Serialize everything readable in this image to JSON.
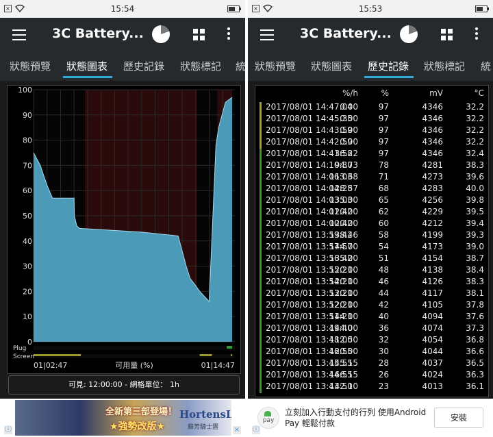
{
  "left": {
    "status": {
      "time": "15:54"
    },
    "app": {
      "title": "3C Battery..."
    },
    "tabs": [
      "狀態預覽",
      "狀態圖表",
      "歷史記錄",
      "狀態標記",
      "統"
    ],
    "active_tab": 1,
    "chart": {
      "x_start": "01|02:47",
      "x_end": "01|14:47",
      "xlabel": "可用量 (%)",
      "plug_label": "Plug",
      "screen_label": "Screen"
    },
    "visible_bar": "可見: 12:00:00 - 網格單位： 1h",
    "ad": {
      "line1": "全新第三部登場！",
      "line2": "★強勢改版★",
      "logo": "HortensIA",
      "logo_sub": "蘇芳騎士團"
    }
  },
  "right": {
    "status": {
      "time": "15:53"
    },
    "app": {
      "title": "3C Battery..."
    },
    "tabs": [
      "狀態預覽",
      "狀態圖表",
      "歷史記錄",
      "狀態標記",
      "統"
    ],
    "active_tab": 2,
    "table": {
      "headers": {
        "rate": "%/h",
        "percent": "%",
        "mv": "mV",
        "temp": "°C"
      },
      "rows": [
        {
          "ts": "2017/08/01  14:47:04",
          "rate": "0.00",
          "pct": "97",
          "mv": "4346",
          "temp": "32.2",
          "mark": "#a8a032"
        },
        {
          "ts": "2017/08/01  14:45:35",
          "rate": "0.00",
          "pct": "97",
          "mv": "4346",
          "temp": "32.2",
          "mark": "#a8a032"
        },
        {
          "ts": "2017/08/01  14:43:59",
          "rate": "0.00",
          "pct": "97",
          "mv": "4346",
          "temp": "32.2",
          "mark": "#a8a032"
        },
        {
          "ts": "2017/08/01  14:42:59",
          "rate": "0.00",
          "pct": "97",
          "mv": "4346",
          "temp": "32.2",
          "mark": "#a8a032"
        },
        {
          "ts": "2017/08/01  14:41:58",
          "rate": "36.22",
          "pct": "97",
          "mv": "4346",
          "temp": "32.4",
          "mark": "#3a9a2a"
        },
        {
          "ts": "2017/08/01  14:10:30",
          "rate": "94.73",
          "pct": "78",
          "mv": "4281",
          "temp": "38.3",
          "mark": "#3a9a2a"
        },
        {
          "ts": "2017/08/01  14:06:03",
          "rate": "113.68",
          "pct": "71",
          "mv": "4273",
          "temp": "39.6",
          "mark": "#3a9a2a"
        },
        {
          "ts": "2017/08/01  14:04:28",
          "rate": "128.57",
          "pct": "68",
          "mv": "4283",
          "temp": "40.0",
          "mark": "#3a9a2a"
        },
        {
          "ts": "2017/08/01  14:03:03",
          "rate": "135.00",
          "pct": "65",
          "mv": "4256",
          "temp": "39.8",
          "mark": "#3a9a2a"
        },
        {
          "ts": "2017/08/01  14:01:42",
          "rate": "120.00",
          "pct": "62",
          "mv": "4229",
          "temp": "39.5",
          "mark": "#3a9a2a"
        },
        {
          "ts": "2017/08/01  14:00:42",
          "rate": "120.00",
          "pct": "60",
          "mv": "4212",
          "temp": "39.4",
          "mark": "#3a9a2a"
        },
        {
          "ts": "2017/08/01  13:59:42",
          "rate": "138.46",
          "pct": "58",
          "mv": "4199",
          "temp": "39.3",
          "mark": "#3a9a2a"
        },
        {
          "ts": "2017/08/01  13:57:57",
          "rate": "144.00",
          "pct": "54",
          "mv": "4173",
          "temp": "39.0",
          "mark": "#3a9a2a"
        },
        {
          "ts": "2017/08/01  13:56:42",
          "rate": "135.00",
          "pct": "51",
          "mv": "4154",
          "temp": "38.7",
          "mark": "#3a9a2a"
        },
        {
          "ts": "2017/08/01  13:55:21",
          "rate": "120.00",
          "pct": "48",
          "mv": "4138",
          "temp": "38.4",
          "mark": "#3a9a2a"
        },
        {
          "ts": "2017/08/01  13:54:21",
          "rate": "120.00",
          "pct": "46",
          "mv": "4126",
          "temp": "38.3",
          "mark": "#3a9a2a"
        },
        {
          "ts": "2017/08/01  13:53:21",
          "rate": "120.00",
          "pct": "44",
          "mv": "4117",
          "temp": "38.1",
          "mark": "#3a9a2a"
        },
        {
          "ts": "2017/08/01  13:52:21",
          "rate": "120.00",
          "pct": "42",
          "mv": "4105",
          "temp": "37.8",
          "mark": "#3a9a2a"
        },
        {
          "ts": "2017/08/01  13:51:21",
          "rate": "144.00",
          "pct": "40",
          "mv": "4094",
          "temp": "37.6",
          "mark": "#3a9a2a"
        },
        {
          "ts": "2017/08/01  13:49:40",
          "rate": "144.00",
          "pct": "36",
          "mv": "4074",
          "temp": "37.3",
          "mark": "#3a9a2a"
        },
        {
          "ts": "2017/08/01  13:48:00",
          "rate": "112.50",
          "pct": "32",
          "mv": "4054",
          "temp": "36.8",
          "mark": "#3a9a2a"
        },
        {
          "ts": "2017/08/01  13:46:55",
          "rate": "120.00",
          "pct": "30",
          "mv": "4044",
          "temp": "36.6",
          "mark": "#3a9a2a"
        },
        {
          "ts": "2017/08/01  13:45:55",
          "rate": "145.15",
          "pct": "28",
          "mv": "4037",
          "temp": "36.5",
          "mark": "#3a9a2a"
        },
        {
          "ts": "2017/08/01  13:44:55",
          "rate": "166.15",
          "pct": "26",
          "mv": "4024",
          "temp": "36.3",
          "mark": "#3a9a2a"
        },
        {
          "ts": "2017/08/01  13:43:50",
          "rate": "142.10",
          "pct": "23",
          "mv": "4013",
          "temp": "36.1",
          "mark": "#3a9a2a"
        }
      ]
    },
    "ad": {
      "pay_label": "pay",
      "text": "立刻加入行動支付的行列 使用Android Pay 輕鬆付款",
      "install": "安裝"
    }
  },
  "chart_data": {
    "type": "area",
    "title": "",
    "xlabel": "可用量 (%)",
    "ylabel": "",
    "ylim": [
      0,
      100
    ],
    "y_ticks": [
      0,
      10,
      20,
      30,
      40,
      50,
      60,
      70,
      80,
      90,
      100
    ],
    "x_start": "01|02:47",
    "x_end": "01|14:47",
    "x_hours": [
      0,
      0.5,
      1.0,
      1.4,
      1.6,
      1.8,
      2.3,
      3.0,
      3.02,
      3.2,
      3.4,
      5.0,
      8.0,
      10.7,
      11.0,
      11.3,
      11.6,
      11.9,
      12.3,
      13.0,
      13.5,
      13.7,
      14.2,
      14.7
    ],
    "values": [
      75,
      70,
      62,
      57,
      57,
      57,
      57,
      57,
      50,
      46,
      45,
      44.5,
      43.5,
      42,
      36,
      30,
      25,
      23,
      20,
      16,
      78,
      85,
      95,
      97
    ],
    "x_range_hours": [
      0,
      14.9
    ],
    "discharge_shading_hours": [
      [
        3.8,
        12.1
      ],
      [
        13.6,
        14.7
      ]
    ],
    "plug_segments_hours": [
      [
        14.3,
        14.7
      ]
    ],
    "screen_segments_hours": [
      [
        0,
        3.5
      ],
      [
        12.3,
        13.2
      ],
      [
        14.6,
        14.7
      ]
    ],
    "grid": true,
    "colors": {
      "area": "#4a9ab8",
      "line": "#a8d8ec",
      "discharge": "#2a0a0a",
      "plug": "#2e9a2e",
      "screen": "#9a9a2a"
    }
  }
}
